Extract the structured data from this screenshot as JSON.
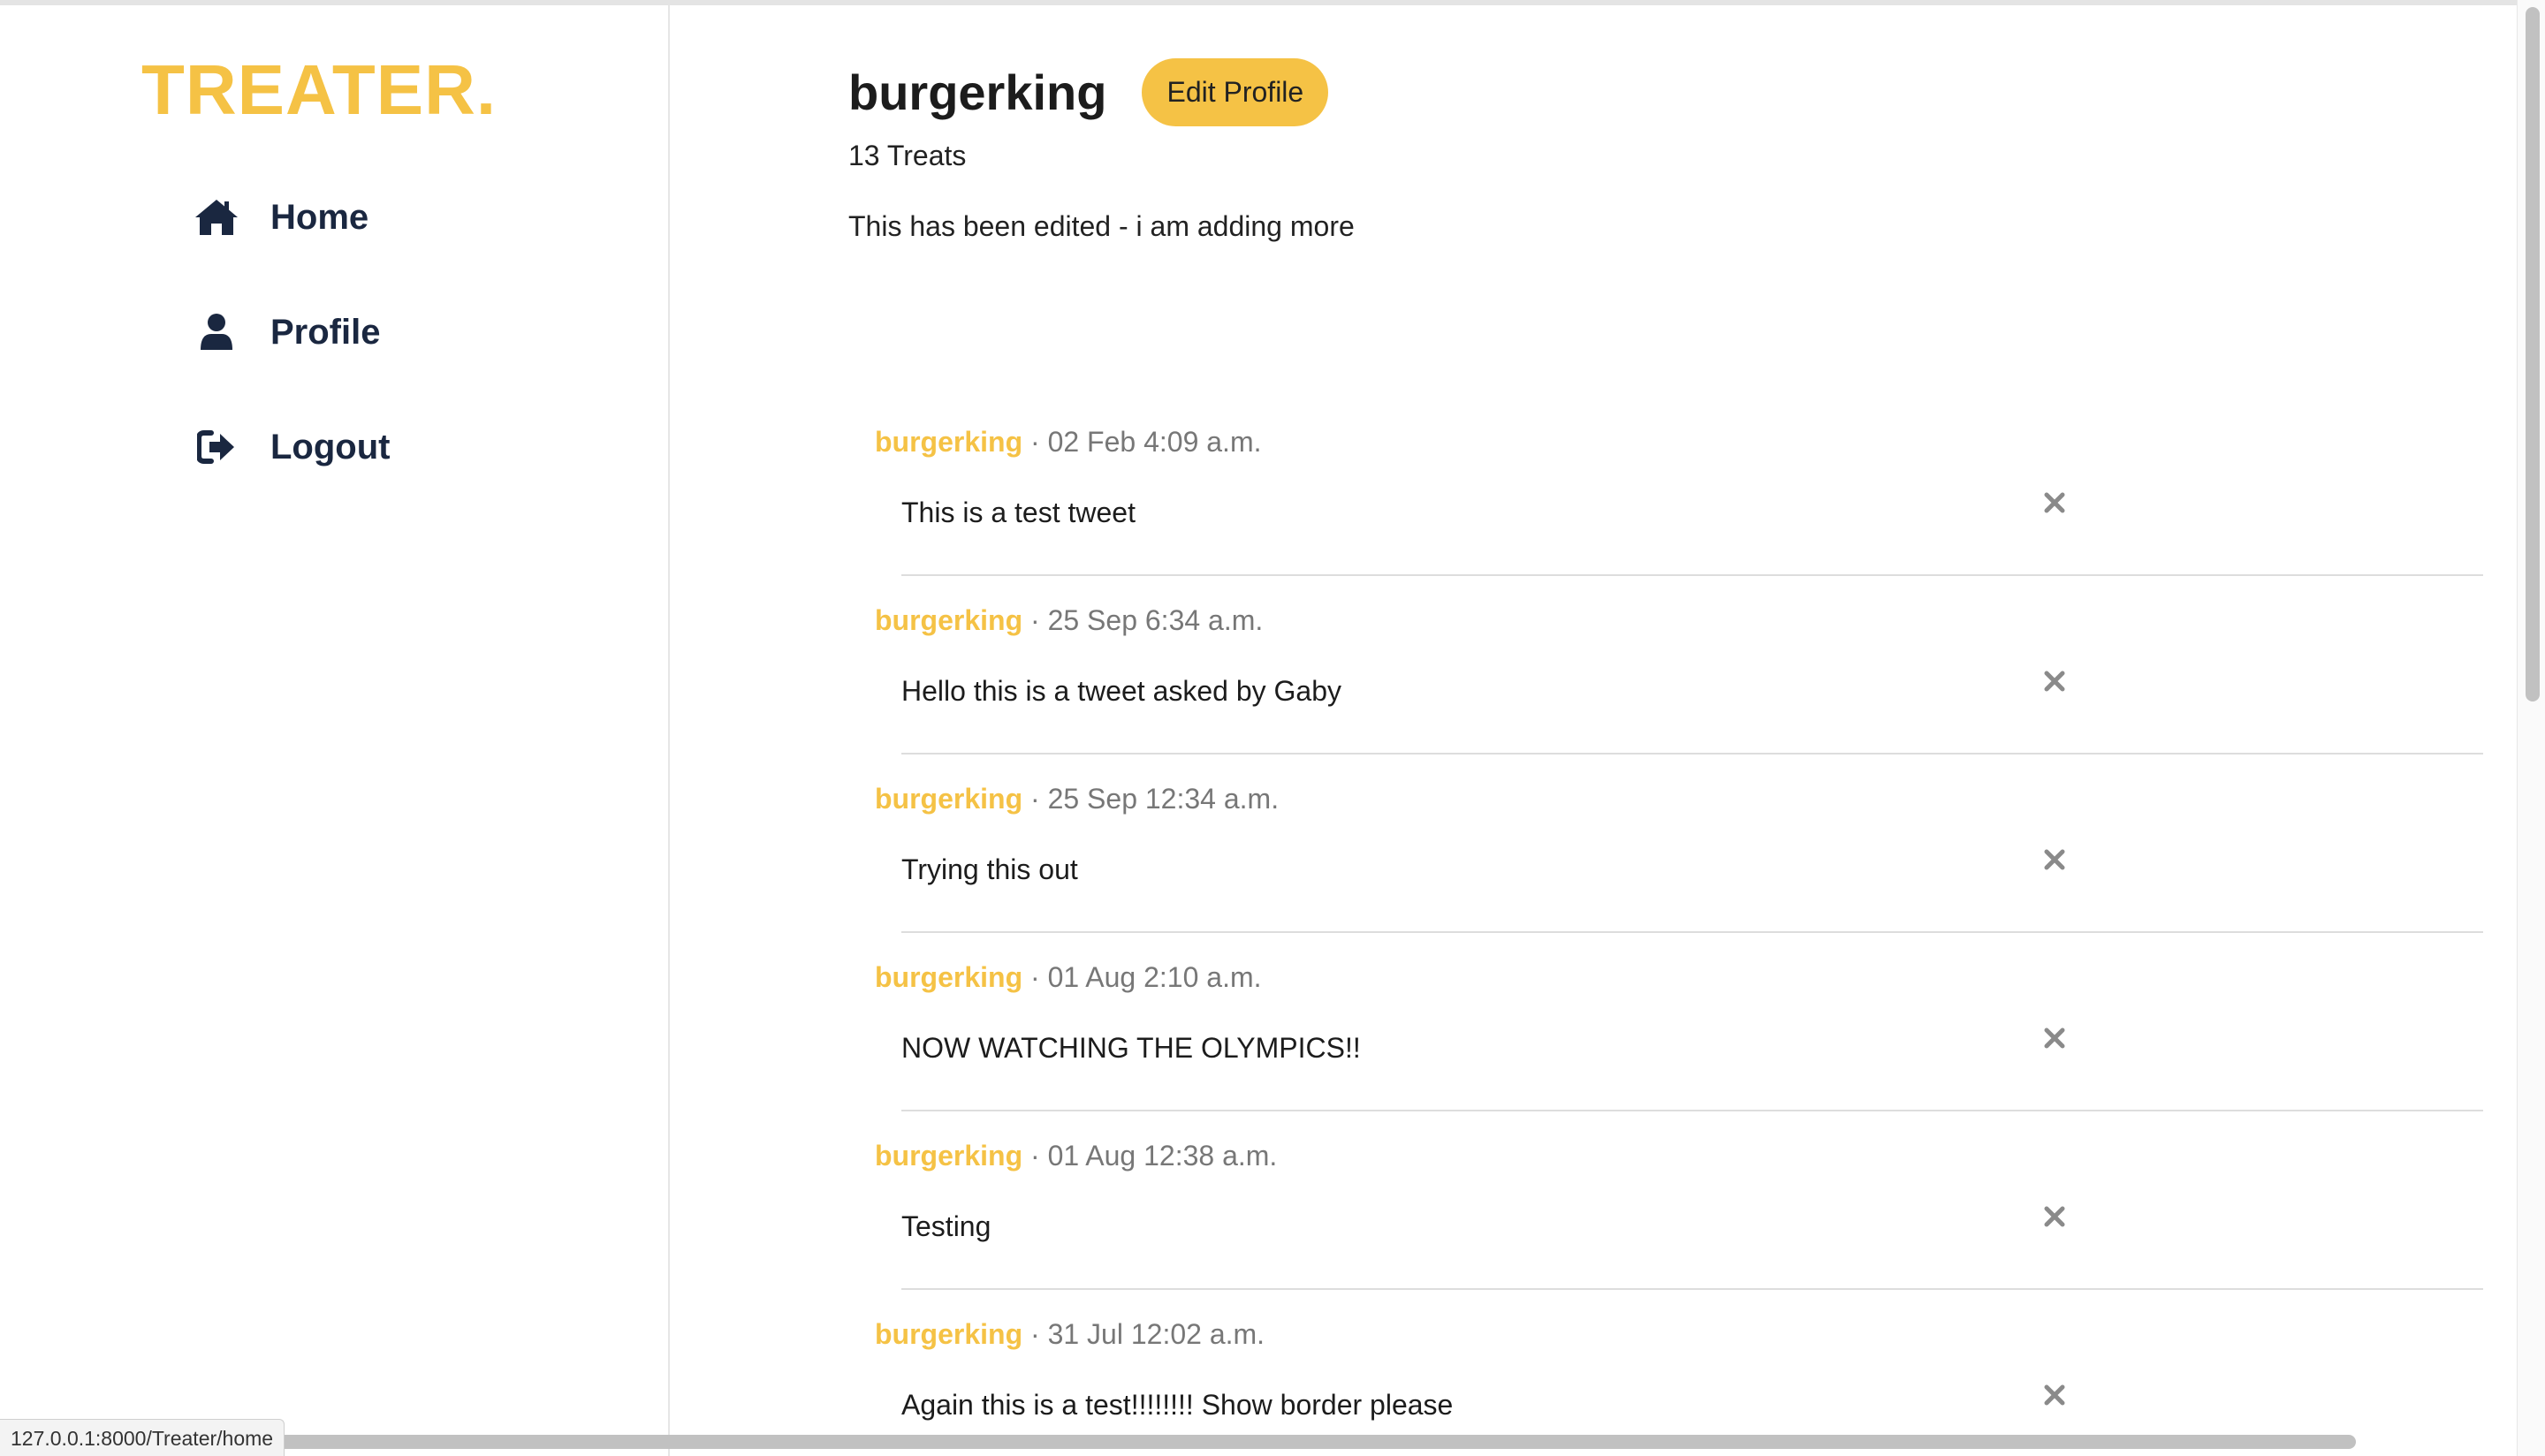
{
  "app": {
    "logo": "TREATER."
  },
  "sidebar": {
    "items": [
      {
        "label": "Home",
        "icon": "home-icon"
      },
      {
        "label": "Profile",
        "icon": "user-icon"
      },
      {
        "label": "Logout",
        "icon": "logout-icon"
      }
    ]
  },
  "profile": {
    "username": "burgerking",
    "edit_label": "Edit Profile",
    "treat_count": "13 Treats",
    "bio": "This has been edited - i am adding more"
  },
  "feed": {
    "separator": " · ",
    "treats": [
      {
        "author": "burgerking",
        "date": "02 Feb 4:09 a.m.",
        "text": "This is a test tweet"
      },
      {
        "author": "burgerking",
        "date": "25 Sep 6:34 a.m.",
        "text": "Hello this is a tweet asked by Gaby"
      },
      {
        "author": "burgerking",
        "date": "25 Sep 12:34 a.m.",
        "text": "Trying this out"
      },
      {
        "author": "burgerking",
        "date": "01 Aug 2:10 a.m.",
        "text": "NOW WATCHING THE OLYMPICS!!"
      },
      {
        "author": "burgerking",
        "date": "01 Aug 12:38 a.m.",
        "text": "Testing"
      },
      {
        "author": "burgerking",
        "date": "31 Jul 12:02 a.m.",
        "text": "Again this is a test!!!!!!!! Show border please"
      }
    ]
  },
  "status_bar": {
    "url": "127.0.0.1:8000/Treater/home"
  },
  "colors": {
    "accent": "#f5c245",
    "nav_text": "#1a2740",
    "meta_text": "#777777"
  }
}
